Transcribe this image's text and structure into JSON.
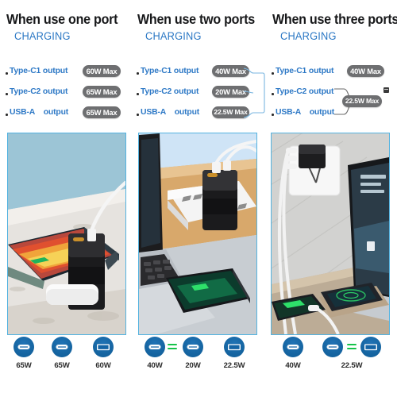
{
  "panels": [
    {
      "title": "When use one port",
      "subtitle": "CHARGING",
      "rows": [
        {
          "label": "Type-C1 output",
          "badge": "60W Max"
        },
        {
          "label": "Type-C2 output",
          "badge": "65W Max"
        },
        {
          "label": "USB-A    output",
          "badge": "65W Max"
        }
      ],
      "ports": [
        {
          "type": "usb-c",
          "watt": "65W"
        },
        {
          "type": "usb-c",
          "watt": "65W"
        },
        {
          "type": "usb-a",
          "watt": "60W"
        }
      ],
      "equals": [],
      "photo_alt": "black-charger-on-white-stand-with-phone"
    },
    {
      "title": "When use two ports",
      "subtitle": "CHARGING",
      "rows": [
        {
          "label": "Type-C1 output",
          "badge": "40W Max"
        },
        {
          "label": "Type-C2 output",
          "badge": "20W Max"
        },
        {
          "label": "USB-A    output",
          "badge": "22.5W Max"
        }
      ],
      "ports": [
        {
          "type": "usb-c",
          "watt": "40W"
        },
        {
          "type": "usb-c",
          "watt": "20W"
        },
        {
          "type": "usb-a",
          "watt": "22.5W"
        }
      ],
      "equals": [
        0
      ],
      "photo_alt": "laptop-power-strip-charger-and-phone"
    },
    {
      "title": "When use three ports",
      "subtitle": "CHARGING",
      "rows": [
        {
          "label": "Type-C1 output",
          "badge": "40W Max"
        },
        {
          "label": "Type-C2 output",
          "badge": ""
        },
        {
          "label": "USB-A    output",
          "badge": ""
        }
      ],
      "shared_badge": "22.5W Max",
      "ports": [
        {
          "type": "usb-c",
          "watt": "40W"
        },
        {
          "type": "usb-c",
          "watt": "22.5W"
        },
        {
          "type": "usb-a",
          "watt": ""
        }
      ],
      "equals": [
        1
      ],
      "photo_alt": "wall-outlet-charger-with-laptop-and-tablet"
    }
  ],
  "colors": {
    "accent_blue": "#2e79c6",
    "badge_gray": "#6e6f71",
    "port_blue": "#1464a5",
    "equals_green": "#16c34a",
    "photo_border": "#54b3e0",
    "title_black": "#17181a"
  },
  "icons": {
    "bullet": "bullet-dot",
    "usb_c": "usb-c-port-icon",
    "usb_a": "usb-a-port-icon",
    "equals": "equals-sign-icon",
    "plug": "plug-connector-icon",
    "brace": "brace-connector"
  }
}
